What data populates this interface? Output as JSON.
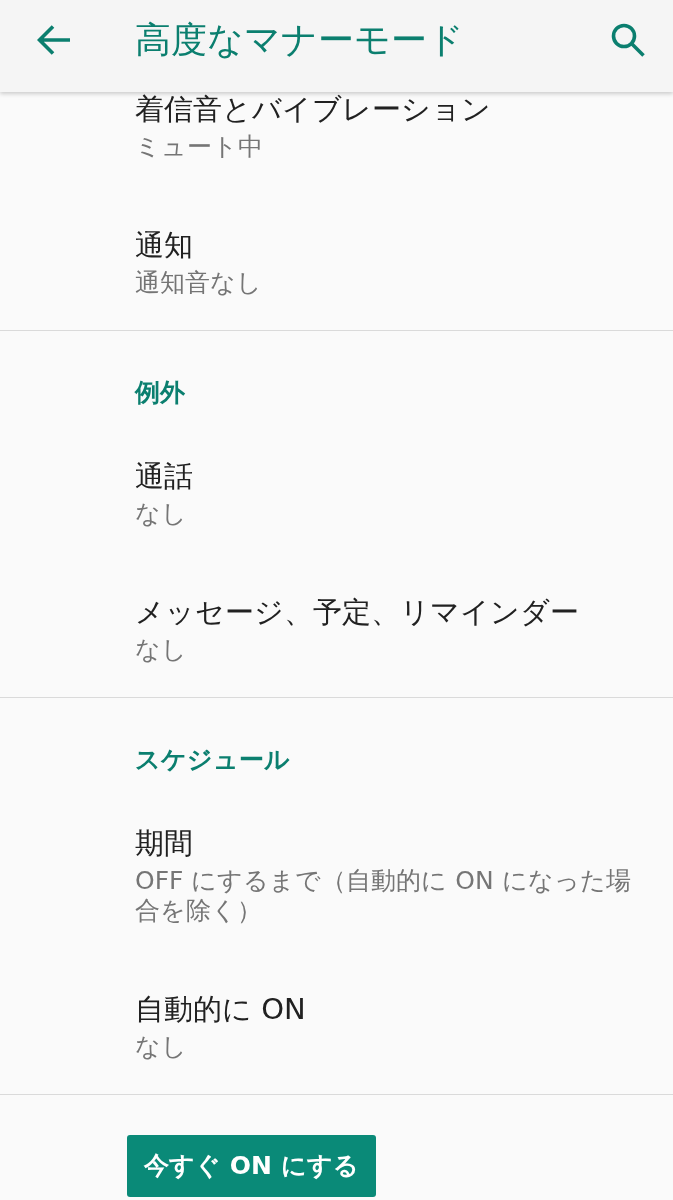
{
  "app_bar": {
    "title": "高度なマナーモード"
  },
  "sections": [
    {
      "items": [
        {
          "title": "着信音とバイブレーション",
          "summary": "ミュート中"
        },
        {
          "title": "通知",
          "summary": "通知音なし"
        }
      ]
    },
    {
      "header": "例外",
      "items": [
        {
          "title": "通話",
          "summary": "なし"
        },
        {
          "title": "メッセージ、予定、リマインダー",
          "summary": "なし"
        }
      ]
    },
    {
      "header": "スケジュール",
      "items": [
        {
          "title": "期間",
          "summary": "OFF にするまで（自動的に ON になった場合を除く）"
        },
        {
          "title": "自動的に ON",
          "summary": "なし"
        }
      ]
    }
  ],
  "button": {
    "label": "今すぐ ON にする"
  }
}
